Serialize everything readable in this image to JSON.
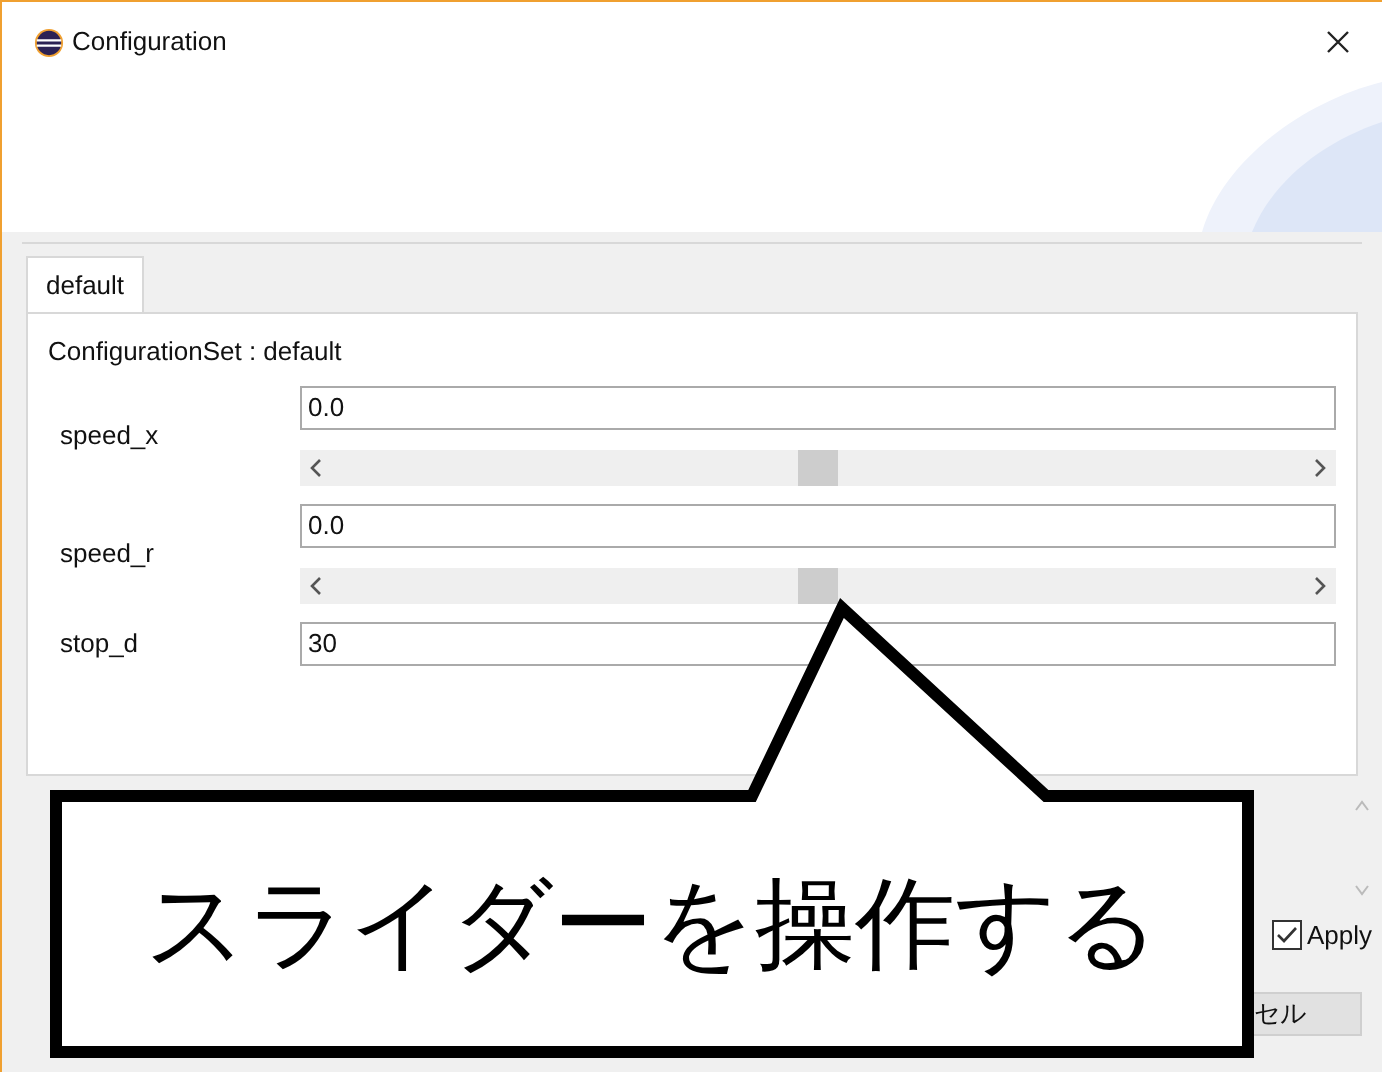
{
  "window": {
    "title": "Configuration"
  },
  "tabs": [
    {
      "label": "default",
      "selected": true
    }
  ],
  "configuration_set": "ConfigurationSet : default",
  "parameters": [
    {
      "kind": "slider",
      "name": "speed_x",
      "value": "0.0",
      "level": 0.5
    },
    {
      "kind": "slider",
      "name": "speed_r",
      "value": "0.0",
      "level": 0.5
    },
    {
      "kind": "text",
      "name": "stop_d",
      "value": "30"
    }
  ],
  "apply": {
    "label": "Apply",
    "checked": true
  },
  "buttons": [
    "セル"
  ],
  "callout": {
    "text": "スライダーを操作する"
  }
}
